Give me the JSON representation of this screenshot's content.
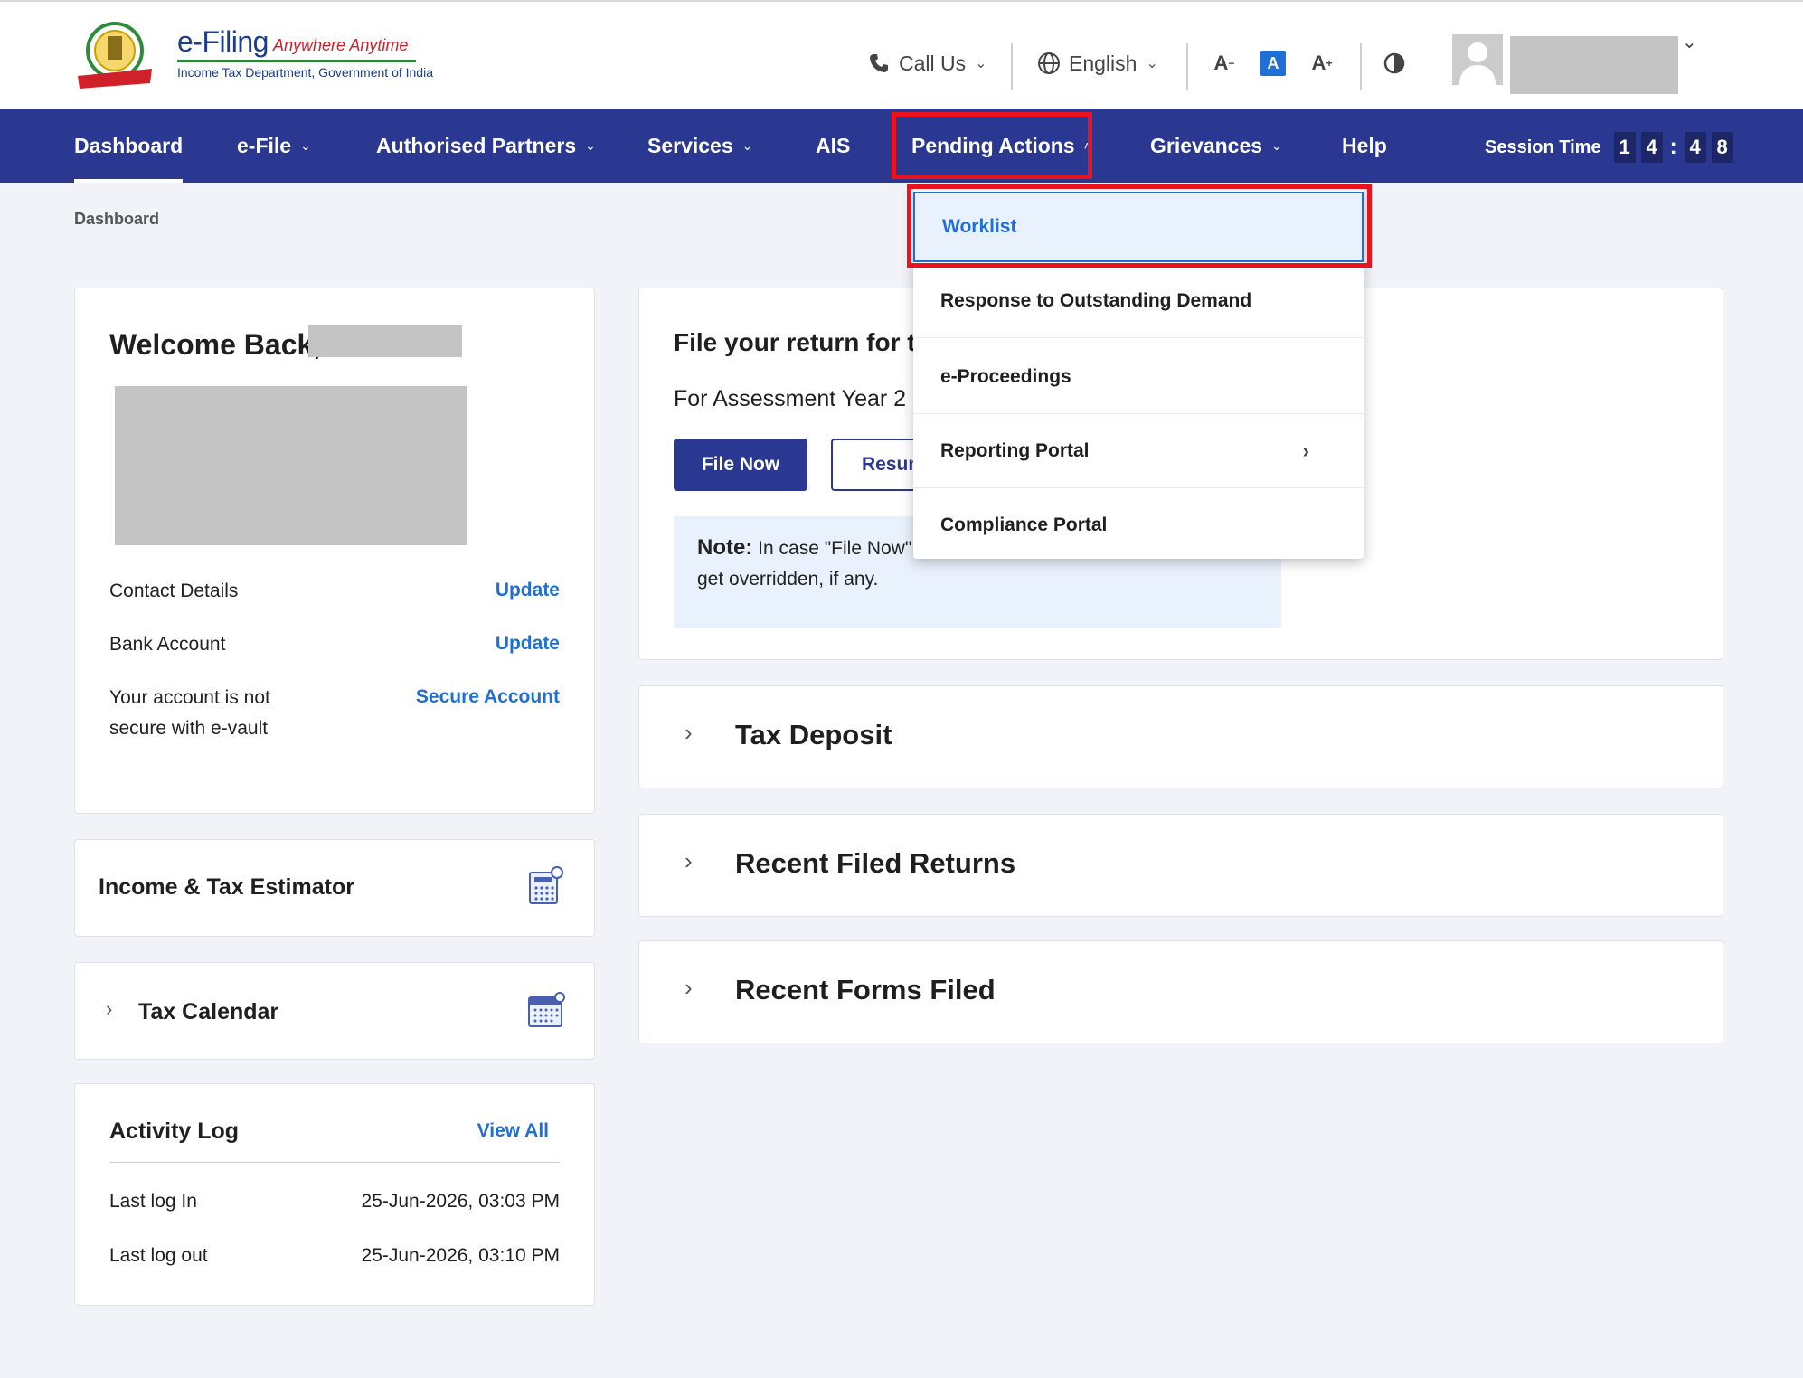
{
  "header": {
    "brand_title": "e-Filing",
    "brand_tagline": "Anywhere Anytime",
    "brand_subtitle": "Income Tax Department, Government of India",
    "call_us": "Call Us",
    "language": "English",
    "font_decrease": "A",
    "font_normal": "A",
    "font_increase": "A"
  },
  "nav": {
    "items": [
      {
        "label": "Dashboard"
      },
      {
        "label": "e-File"
      },
      {
        "label": "Authorised Partners"
      },
      {
        "label": "Services"
      },
      {
        "label": "AIS"
      },
      {
        "label": "Pending Actions"
      },
      {
        "label": "Grievances"
      },
      {
        "label": "Help"
      }
    ],
    "session_label": "Session Time",
    "session_digits": [
      "1",
      "4",
      "4",
      "8"
    ]
  },
  "breadcrumb": "Dashboard",
  "profile_card": {
    "welcome": "Welcome Back,",
    "rows": [
      {
        "label": "Contact Details",
        "action": "Update"
      },
      {
        "label": "Bank Account",
        "action": "Update"
      },
      {
        "label": "Your account is not secure with e-vault",
        "action": "Secure Account"
      }
    ]
  },
  "estimator": {
    "title": "Income & Tax Estimator"
  },
  "calendar": {
    "title": "Tax Calendar"
  },
  "activity": {
    "title": "Activity Log",
    "view_all": "View All",
    "last_login_label": "Last log In",
    "last_login_value": "25-Jun-2026, 03:03 PM",
    "last_logout_label": "Last log out",
    "last_logout_value": "25-Jun-2026, 03:10 PM"
  },
  "file_return": {
    "title": "File your return for t",
    "ay": "For Assessment Year 2",
    "file_now": "File Now",
    "resume": "Resum",
    "note_label": "Note:",
    "note_text": " In case \"File Now\" is selected, existing \"Saved Draft\" will get overridden, if any."
  },
  "accordions": {
    "tax_deposit": "Tax Deposit",
    "recent_returns": "Recent Filed Returns",
    "recent_forms": "Recent Forms Filed"
  },
  "pending_menu": {
    "items": [
      {
        "label": "Worklist"
      },
      {
        "label": "Response to Outstanding Demand"
      },
      {
        "label": "e-Proceedings"
      },
      {
        "label": "Reporting Portal"
      },
      {
        "label": "Compliance Portal"
      }
    ]
  },
  "colors": {
    "nav_bg": "#2b3891",
    "link": "#1f6fd6",
    "highlight": "#e8131f"
  }
}
